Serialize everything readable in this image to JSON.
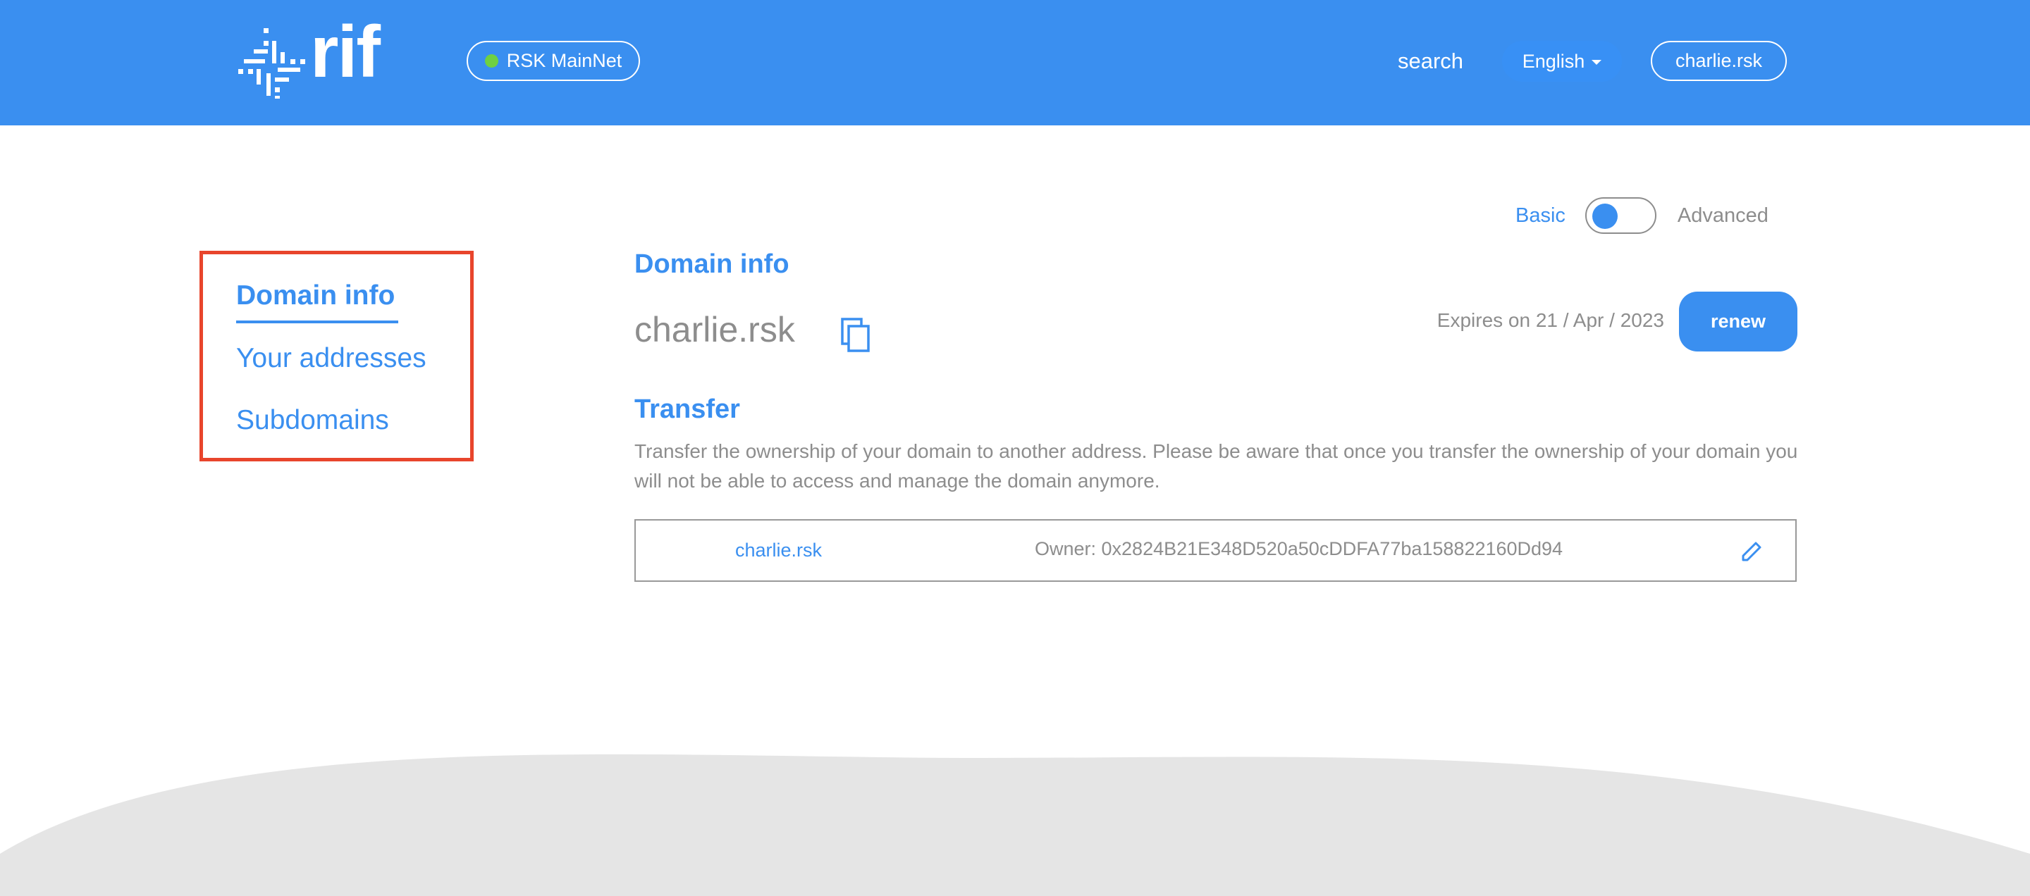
{
  "header": {
    "logo_text": "rif",
    "network": {
      "label": "RSK MainNet",
      "status_color": "#6fd042"
    },
    "nav_search": "search",
    "language": {
      "selected": "English"
    },
    "account": "charlie.rsk",
    "brand_color": "#3a8ff0"
  },
  "mode_toggle": {
    "left_label": "Basic",
    "right_label": "Advanced",
    "selected": "Basic"
  },
  "sidebar": {
    "items": [
      {
        "label": "Domain info",
        "active": true
      },
      {
        "label": "Your addresses",
        "active": false
      },
      {
        "label": "Subdomains",
        "active": false
      }
    ],
    "highlight_color": "#e8452c"
  },
  "domain_info": {
    "title": "Domain info",
    "domain": "charlie.rsk",
    "expires": "Expires on 21 / Apr / 2023",
    "renew_label": "renew"
  },
  "transfer": {
    "title": "Transfer",
    "description": "Transfer the ownership of your domain to another address. Please be aware that once you transfer the ownership of your domain you will not be able to access and manage the domain anymore.",
    "domain": "charlie.rsk",
    "owner": "Owner: 0x2824B21E348D520a50cDDFA77ba158822160Dd94"
  }
}
